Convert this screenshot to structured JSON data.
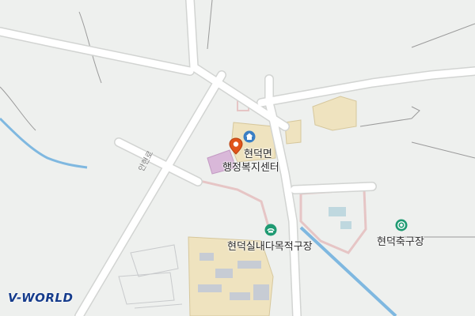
{
  "map": {
    "labels": {
      "welfare_center_line1": "현덕면",
      "welfare_center_line2": "행정복지센터",
      "indoor_gym": "현덕실내다목적구장",
      "soccer_field": "현덕축구장",
      "road_name": "안현로"
    },
    "icons": {
      "marker": "location-pin-icon",
      "government": "house-icon",
      "gym": "sports-facility-icon",
      "soccer": "soccer-ball-icon"
    },
    "colors": {
      "background": "#eef0ee",
      "road": "#ffffff",
      "road_edge": "#d2d4d2",
      "water": "#7fb8e0",
      "building": "#efe3bf",
      "poi_green": "#1f9a72",
      "poi_blue": "#3a7fc4",
      "marker": "#e0541a"
    }
  },
  "branding": {
    "logo_text": "V-WORLD"
  }
}
